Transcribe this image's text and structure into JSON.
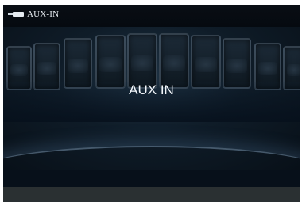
{
  "header": {
    "source_label": "AUX-IN",
    "icon": "input-plug-icon"
  },
  "stage": {
    "title": "AUX IN"
  },
  "colors": {
    "background": "#06101c",
    "text": "#e8edf2",
    "bottom_bar": "#2a3032"
  }
}
